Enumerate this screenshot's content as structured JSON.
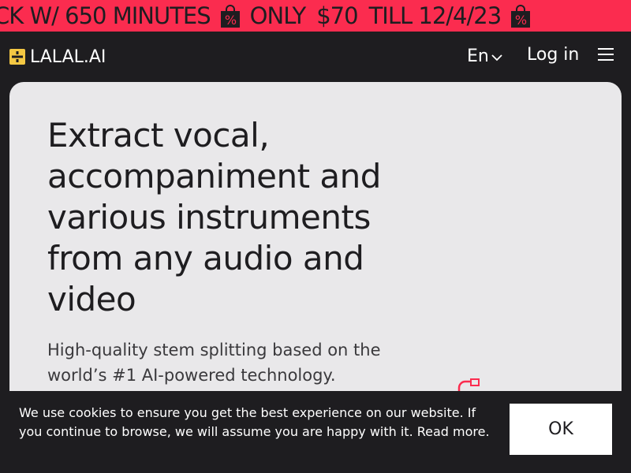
{
  "promo": {
    "parts": [
      "CK W/ 650 MINUTES",
      "ONLY",
      "$70",
      "TILL 12/4/23"
    ],
    "bag_icon": "shopping-bag-percent-icon",
    "bg_color": "#fb2c4f"
  },
  "header": {
    "logo_text": "LALAL.AI",
    "logo_icon": "lalal-logo-icon",
    "lang_label": "En",
    "login_label": "Log in",
    "menu_icon": "hamburger-menu-icon"
  },
  "hero": {
    "title": "Extract vocal, accompaniment and various instruments from any audio and video",
    "subtitle": "High-quality stem splitting based on the world’s #1 AI-powered technology."
  },
  "cookie": {
    "text": "We use cookies to ensure you get the best experience on our website. If you continue to browse, we will assume you are happy with it. ",
    "link_label": "Read more.",
    "ok_label": "OK"
  },
  "colors": {
    "accent": "#fb2c4f",
    "dark": "#1e1d20",
    "card": "#e9e8ea",
    "logo_yellow": "#f4c843"
  }
}
